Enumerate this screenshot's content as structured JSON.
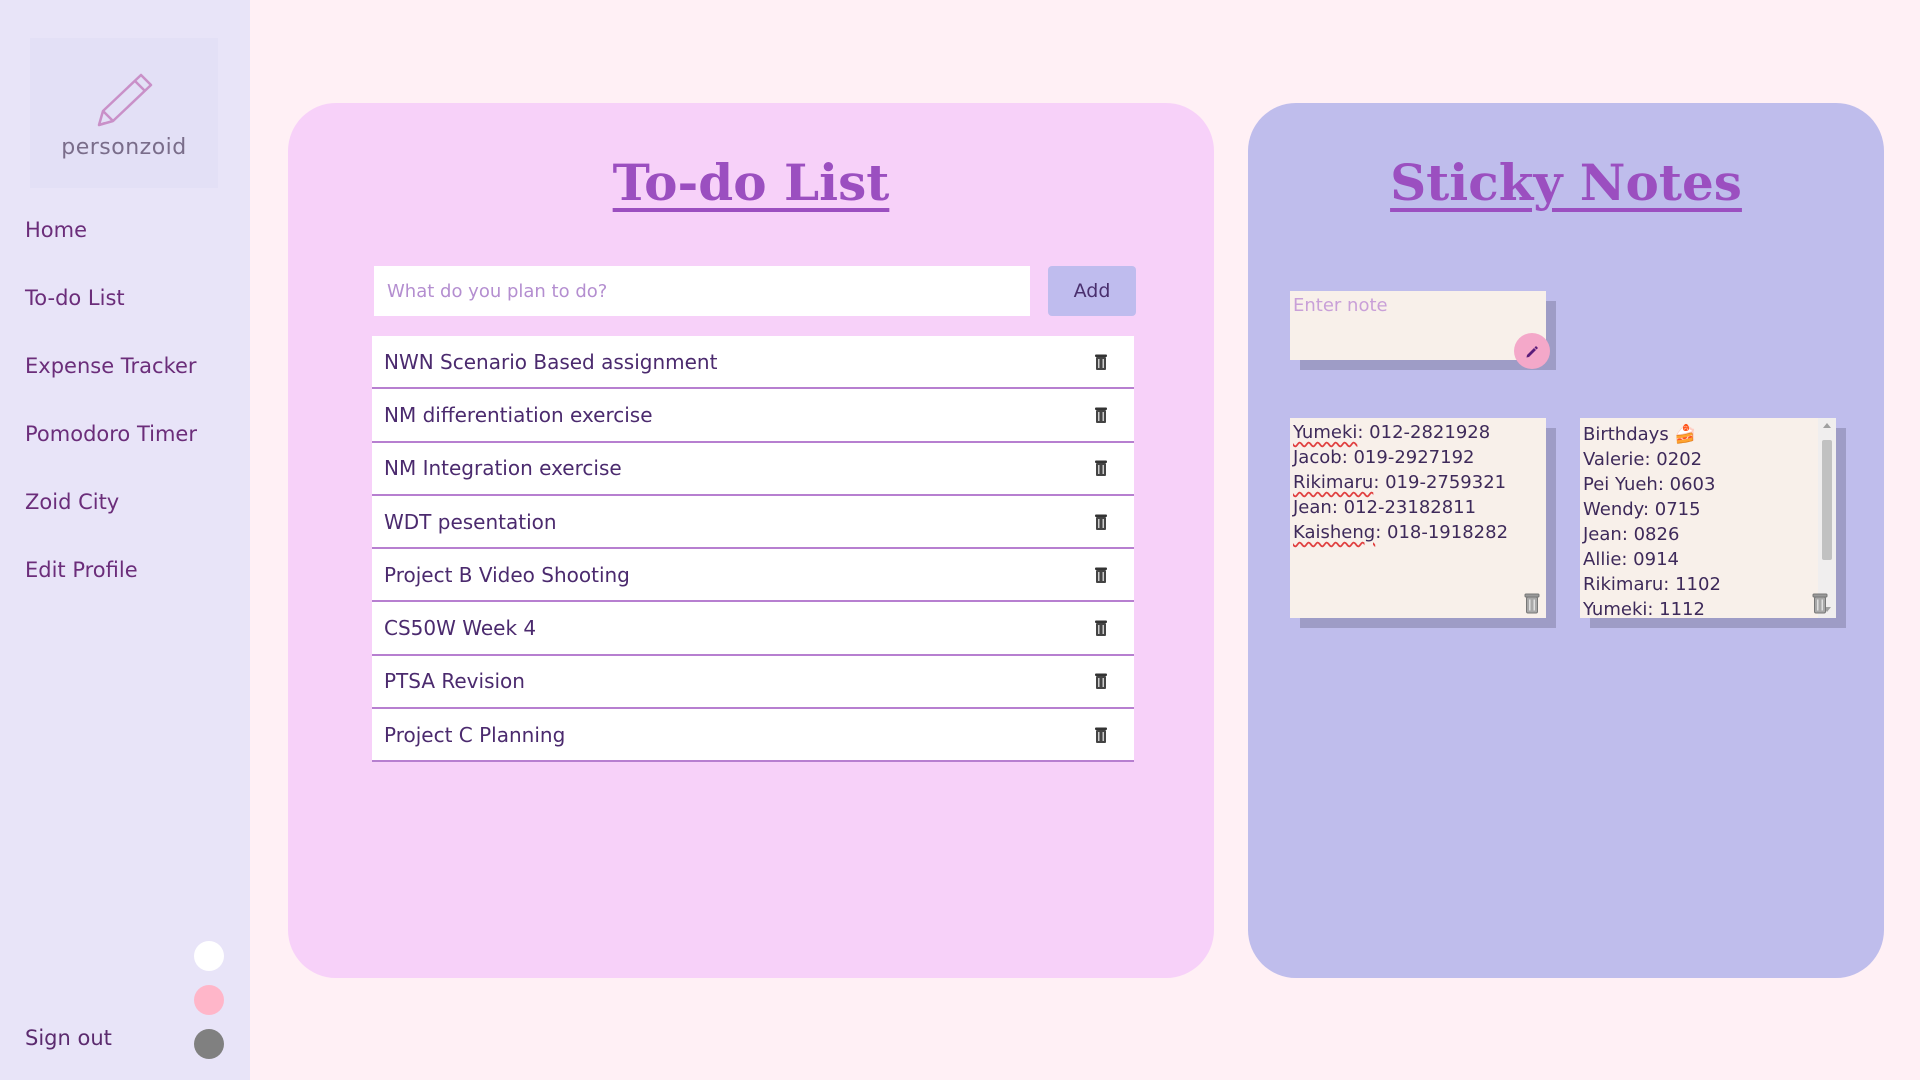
{
  "sidebar": {
    "logo_text": "personzoid",
    "nav": [
      "Home",
      "To-do List",
      "Expense Tracker",
      "Pomodoro Timer",
      "Zoid City",
      "Edit Profile"
    ],
    "signout": "Sign out",
    "theme_colors": [
      "#ffffff",
      "#ffb6c9",
      "#808080"
    ]
  },
  "todo": {
    "title": "To-do List",
    "input_placeholder": "What do you plan to do?",
    "add_label": "Add",
    "items": [
      "NWN Scenario Based assignment",
      "NM differentiation exercise",
      "NM Integration exercise",
      "WDT pesentation",
      "Project B Video Shooting",
      "CS50W Week 4",
      "PTSA Revision",
      "Project C Planning"
    ]
  },
  "notes": {
    "title": "Sticky Notes",
    "input_placeholder": "Enter note",
    "note1": {
      "lines": [
        {
          "name": "Yumeki",
          "value": ": 012-2821928",
          "squiggle": true
        },
        {
          "name": "Jacob",
          "value": ": 019-2927192",
          "squiggle": false
        },
        {
          "name": "Rikimaru",
          "value": ": 019-2759321",
          "squiggle": true
        },
        {
          "name": "Jean",
          "value": ": 012-23182811",
          "squiggle": false
        },
        {
          "name": "Kaisheng",
          "value": ": 018-1918282",
          "squiggle": true
        }
      ]
    },
    "note2": {
      "lines": [
        "Birthdays 🍰",
        "Valerie: 0202",
        "Pei Yueh: 0603",
        "Wendy: 0715",
        "Jean: 0826",
        "Allie: 0914",
        "Rikimaru: 1102",
        "Yumeki: 1112"
      ]
    }
  },
  "colors": {
    "page_bg": "#fff0f5",
    "sidebar_bg": "#e8e4f8",
    "todo_panel": "#f7d1f9",
    "notes_panel": "#bfbdec",
    "title_color": "#9b4fc0",
    "note_bg": "#f8f0ea"
  }
}
